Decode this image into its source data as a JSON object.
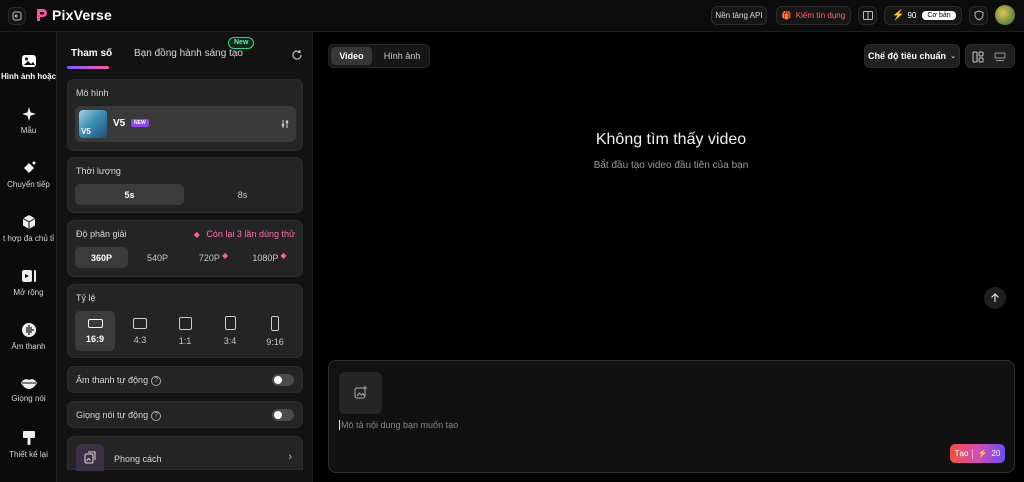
{
  "brand": {
    "name": "PixVerse"
  },
  "topbar": {
    "api_label": "Nền tảng API",
    "earn_label": "Kiếm tín dụng",
    "credits": "90",
    "plan": "Cơ bản"
  },
  "nav": [
    {
      "label": "Hình ảnh hoặc",
      "icon": "image-icon"
    },
    {
      "label": "Mẫu",
      "icon": "sparkle-icon"
    },
    {
      "label": "Chuyển tiếp",
      "icon": "transition-icon"
    },
    {
      "label": "t hợp đa chủ tỉ",
      "icon": "cube-icon"
    },
    {
      "label": "Mở rộng",
      "icon": "extend-icon"
    },
    {
      "label": "Âm thanh",
      "icon": "sound-icon"
    },
    {
      "label": "Giọng nói",
      "icon": "lips-icon"
    },
    {
      "label": "Thiết kế lại",
      "icon": "brush-icon"
    }
  ],
  "panel": {
    "tabs": {
      "params": "Tham số",
      "companion": "Bạn đồng hành sáng tạo",
      "new_badge": "New"
    },
    "model": {
      "title": "Mô hình",
      "name": "V5",
      "badge": "NEW"
    },
    "duration": {
      "title": "Thời lượng",
      "options": [
        "5s",
        "8s"
      ],
      "selected": "5s"
    },
    "resolution": {
      "title": "Độ phân giải",
      "remaining": "Còn lại 3 lần dùng thử",
      "options": [
        "360P",
        "540P",
        "720P",
        "1080P"
      ],
      "selected": "360P"
    },
    "ratio": {
      "title": "Tỷ lệ",
      "options": [
        "16:9",
        "4:3",
        "1:1",
        "3:4",
        "9:16"
      ],
      "selected": "16:9"
    },
    "auto_sound": {
      "label": "Âm thanh tự động",
      "on": false
    },
    "auto_voice": {
      "label": "Giọng nói tự động",
      "on": false
    },
    "style": {
      "label": "Phong cách"
    }
  },
  "main": {
    "tabs": [
      "Video",
      "Hình ảnh"
    ],
    "selected_tab": "Video",
    "mode": "Chế độ tiêu chuẩn",
    "empty_title": "Không tìm thấy video",
    "empty_sub": "Bắt đầu tạo video đầu tiên của bạn",
    "prompt_placeholder": "Mô tả nội dung bạn muốn tạo",
    "create_label": "Tạo",
    "create_cost": "20"
  },
  "colors": {
    "accent": "#ff5aa8",
    "create_gradient_start": "#f0523f",
    "create_gradient_end": "#6a4cf0"
  }
}
